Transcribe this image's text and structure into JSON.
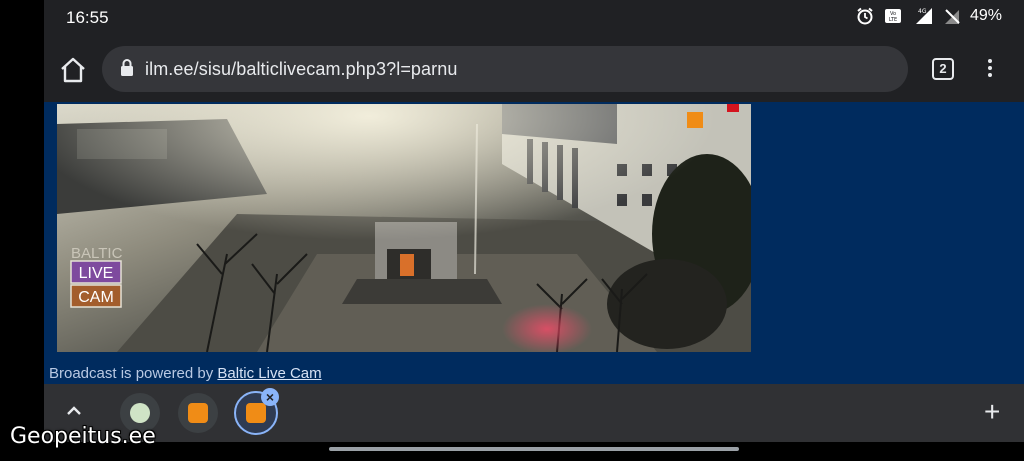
{
  "status": {
    "time": "16:55",
    "battery": "49%",
    "volte": "VoLTE",
    "network": "4G"
  },
  "browser": {
    "url": "ilm.ee/sisu/balticlivecam.php3?l=parnu",
    "tab_count": "2"
  },
  "page": {
    "powered_text": "Broadcast is powered by ",
    "powered_link": "Baltic Live Cam",
    "cam_logo_line1": "BALTIC",
    "cam_logo_line2": "LIVE",
    "cam_logo_line3": "CAM",
    "colors": {
      "background": "#002b5e",
      "link": "#d6e2f5"
    }
  },
  "bottom": {
    "plus": "+",
    "close": "×"
  },
  "watermark": "Geopeitus.ee"
}
